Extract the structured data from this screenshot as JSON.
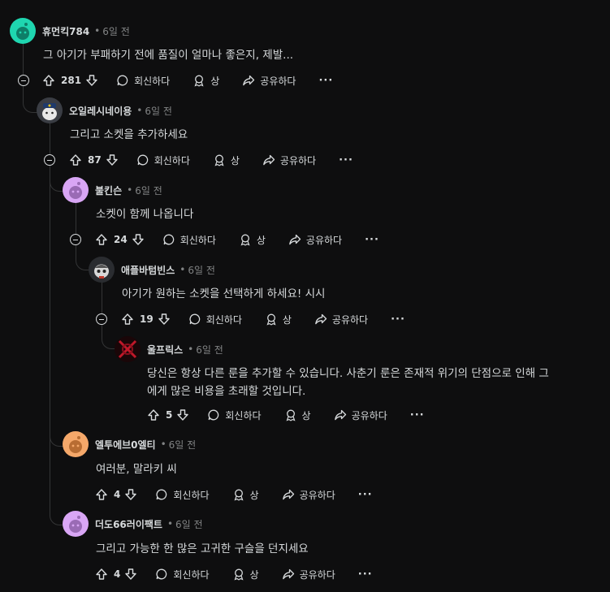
{
  "actions": {
    "reply_label": "회신하다",
    "award_label": "상",
    "share_label": "공유하다",
    "more_label": "···",
    "dot": "•"
  },
  "comments": [
    {
      "author": "휴먼킥784",
      "time": "6일 전",
      "text": "그 아기가 부패하기 전에 품질이 얼마나 좋은지, 제발...",
      "votes": "281",
      "avatar_color": "#1fd6b0"
    },
    {
      "author": "오일레시네이용",
      "time": "6일 전",
      "text": "그리고 소켓을 추가하세요",
      "votes": "87",
      "avatar_color": "#3a3d44"
    },
    {
      "author": "불킨슨",
      "time": "6일 전",
      "text": "소켓이 함께 나옵니다",
      "votes": "24",
      "avatar_color": "#d9a6f5"
    },
    {
      "author": "애플바텀빈스",
      "time": "6일 전",
      "text": "아기가 원하는 소켓을 선택하게 하세요! 시시",
      "votes": "19",
      "avatar_color": "#2a2c30"
    },
    {
      "author": "울프릭스",
      "time": "6일 전",
      "text_line1": "당신은 항상 다른 룬을 추가할 수 있습니다. 사춘기 룬은 존재적 위기의 단점으로 인해 그",
      "text_line2": "에게 많은 비용을 초래할 것입니다.",
      "votes": "5",
      "avatar_color": "#1a0608"
    },
    {
      "author": "엘투에브0엘티",
      "time": "6일 전",
      "text": "여러분, 말라키 씨",
      "votes": "4",
      "avatar_color": "#f5a86a"
    },
    {
      "author": "더도66러이팩트",
      "time": "6일 전",
      "text": "그리고 가능한 한 많은 고귀한 구슬을 던지세요",
      "votes": "4",
      "avatar_color": "#d9a6f5"
    }
  ]
}
